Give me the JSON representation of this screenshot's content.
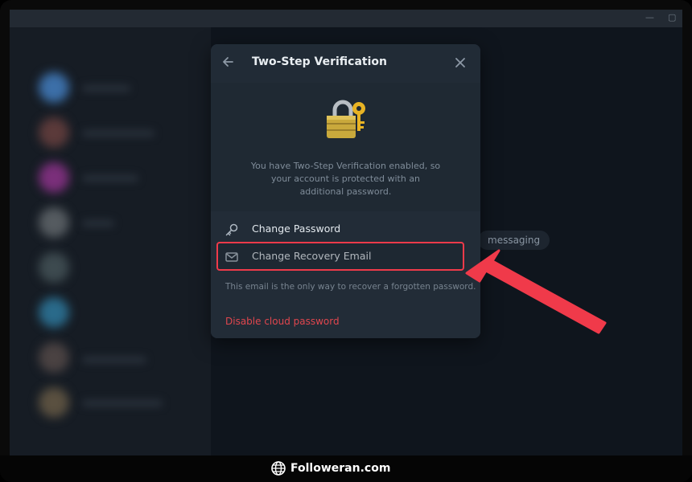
{
  "dialog": {
    "title": "Two-Step Verification",
    "info_line1": "You have Two-Step Verification enabled, so",
    "info_line2": "your account is protected with an",
    "info_line3": "additional password.",
    "items": [
      {
        "label": "Change Password",
        "icon": "key-icon"
      },
      {
        "label": "Change Recovery Email",
        "icon": "mail-icon"
      }
    ],
    "hint": "This email is the only way to recover a forgotten password.",
    "disable_label": "Disable cloud password"
  },
  "background": {
    "pill_text": "messaging"
  },
  "footer": {
    "brand": "Followeran.com",
    "icon": "globe-icon"
  },
  "colors": {
    "accent_red": "#f03a4a",
    "danger_text": "#e0464e",
    "dialog_bg": "#202a34"
  }
}
